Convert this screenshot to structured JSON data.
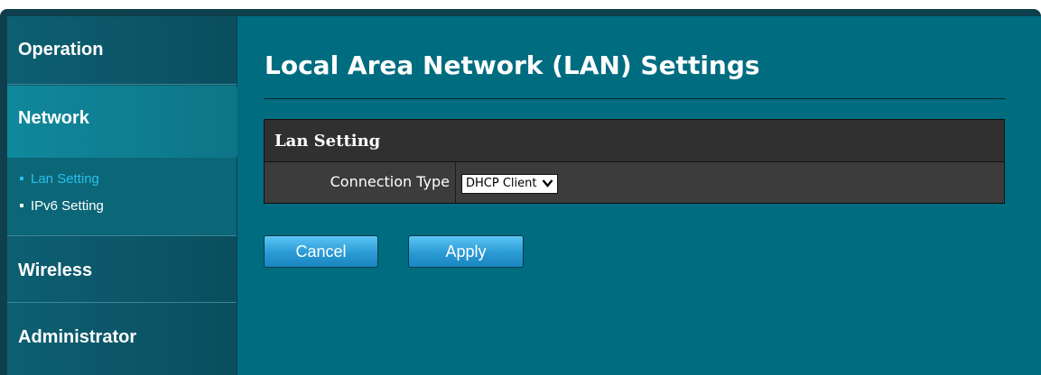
{
  "sidebar": {
    "operation": "Operation",
    "network": "Network",
    "network_items": [
      "Lan Setting",
      "IPv6 Setting"
    ],
    "wireless": "Wireless",
    "administrator": "Administrator"
  },
  "main": {
    "title": "Local Area Network (LAN) Settings",
    "panel": {
      "header": "Lan Setting",
      "connection_type_label": "Connection Type",
      "connection_type_value": "DHCP Client"
    },
    "buttons": {
      "cancel": "Cancel",
      "apply": "Apply"
    }
  },
  "icons": {
    "select_chevron": "chevron-down-icon",
    "nav_bullet": "bullet-icon",
    "active_arrow": "arrow-right-icon"
  },
  "colors": {
    "sidebar_bg": "#0c5a6c",
    "main_bg": "#006c80",
    "active_link": "#28c0ee",
    "panel_bg": "#3a3a3a",
    "button_bg": "#2a9ad4"
  }
}
